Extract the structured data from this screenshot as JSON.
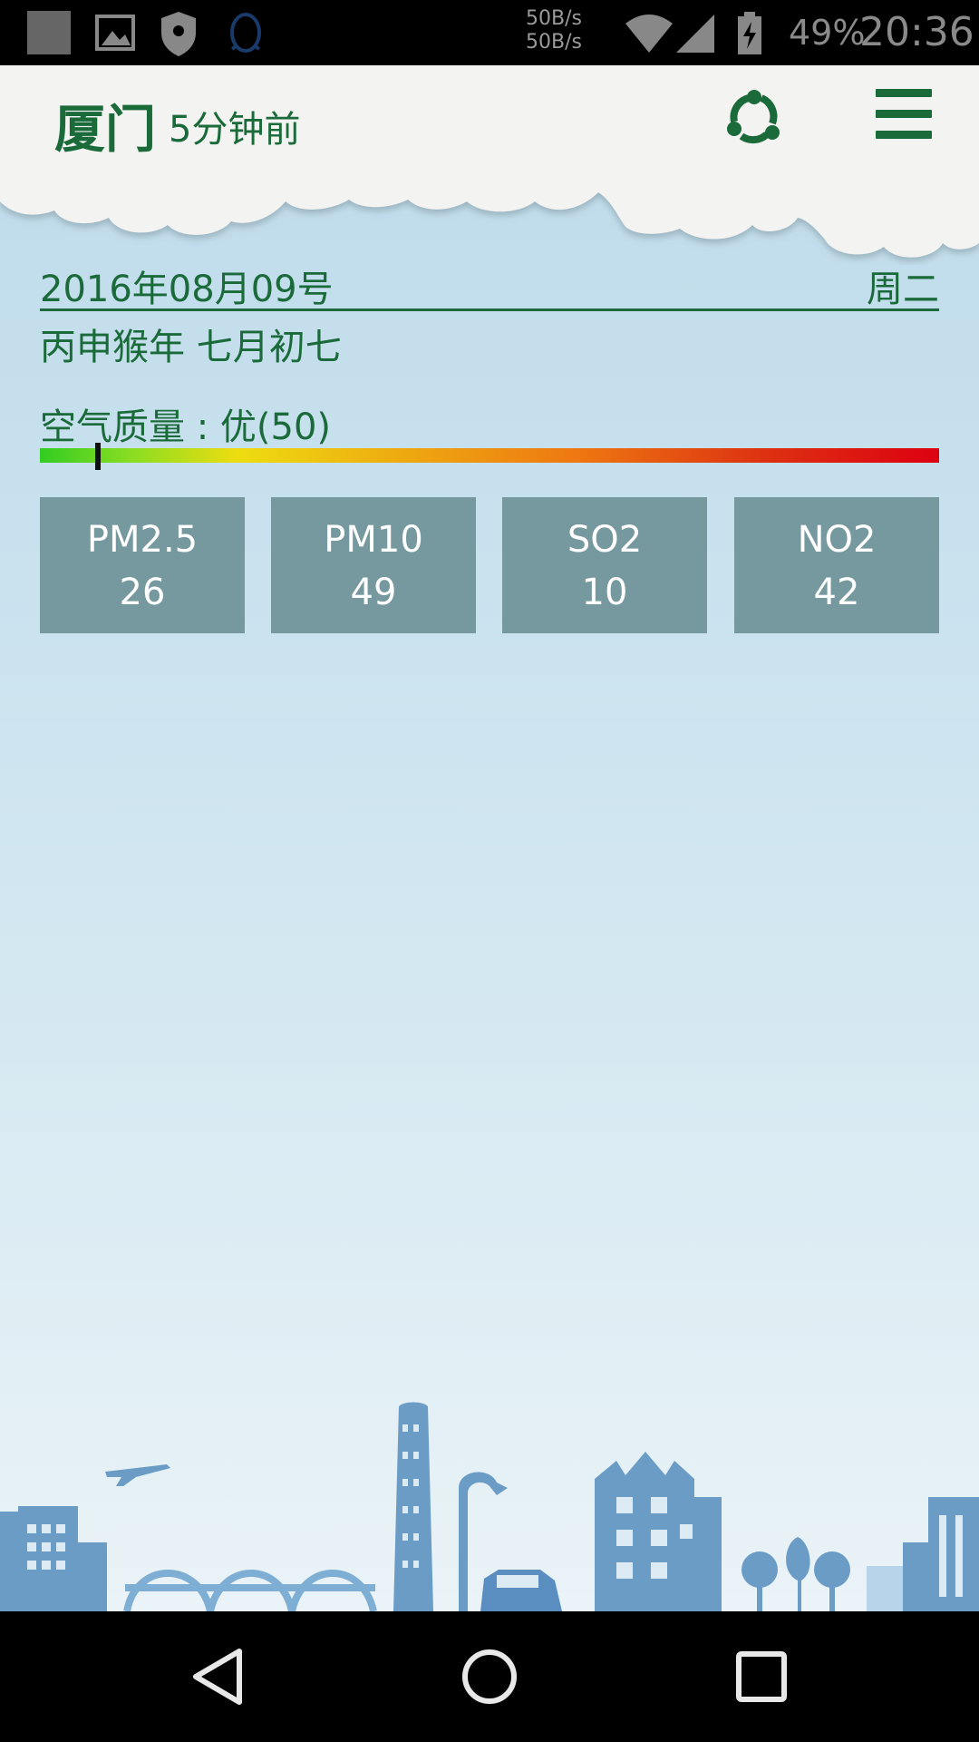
{
  "status_bar": {
    "net_up": "50B/s",
    "net_down": "50B/s",
    "battery_percent": "49%",
    "time": "20:36"
  },
  "header": {
    "city": "厦门",
    "updated": "5分钟前"
  },
  "date": {
    "gregorian": "2016年08月09号",
    "weekday": "周二",
    "lunar": "丙申猴年 七月初七"
  },
  "air_quality": {
    "label": "空气质量 : 优(50)",
    "aqi": 50,
    "marker_fraction": 0.065
  },
  "pollutants": [
    {
      "name": "PM2.5",
      "value": "26"
    },
    {
      "name": "PM10",
      "value": "49"
    },
    {
      "name": "SO2",
      "value": "10"
    },
    {
      "name": "NO2",
      "value": "42"
    }
  ],
  "colors": {
    "accent": "#1a6a3a",
    "card": "#76999f"
  }
}
